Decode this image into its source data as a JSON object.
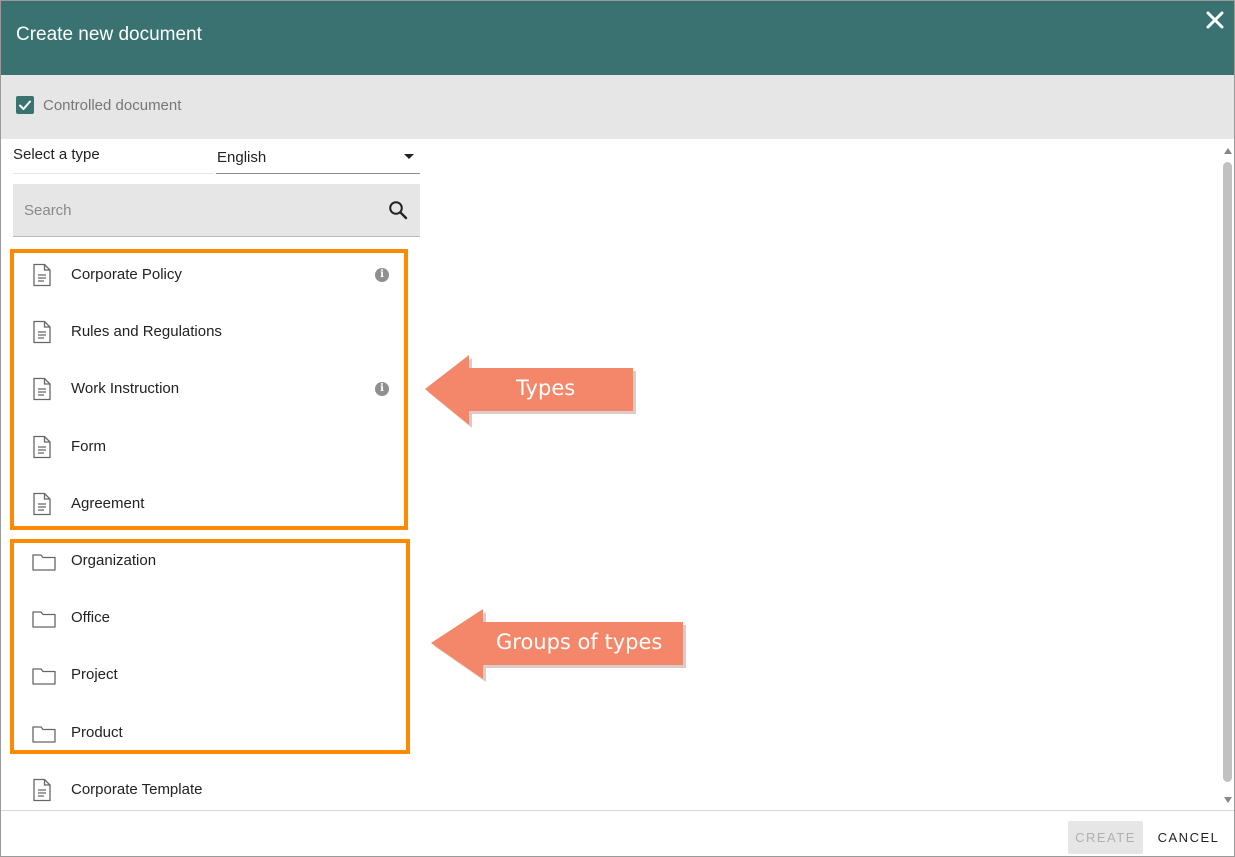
{
  "dialog": {
    "title": "Create new document",
    "header_color": "#3a7272"
  },
  "controlled": {
    "checked": true,
    "label": "Controlled document"
  },
  "type_selector": {
    "label": "Select a type",
    "language": "English"
  },
  "search": {
    "placeholder": "Search"
  },
  "items": [
    {
      "label": "Corporate Policy",
      "kind": "document",
      "info": true
    },
    {
      "label": "Rules and Regulations",
      "kind": "document",
      "info": false
    },
    {
      "label": "Work Instruction",
      "kind": "document",
      "info": true
    },
    {
      "label": "Form",
      "kind": "document",
      "info": false
    },
    {
      "label": "Agreement",
      "kind": "document",
      "info": false
    },
    {
      "label": "Organization",
      "kind": "folder",
      "info": false
    },
    {
      "label": "Office",
      "kind": "folder",
      "info": false
    },
    {
      "label": "Project",
      "kind": "folder",
      "info": false
    },
    {
      "label": "Product",
      "kind": "folder",
      "info": false
    },
    {
      "label": "Corporate Template",
      "kind": "document",
      "info": false
    }
  ],
  "annotations": {
    "types_label": "Types",
    "groups_label": "Groups of types",
    "highlight_color": "#ff8a00",
    "arrow_color": "#f4876a"
  },
  "footer": {
    "create_label": "CREATE",
    "cancel_label": "CANCEL"
  }
}
